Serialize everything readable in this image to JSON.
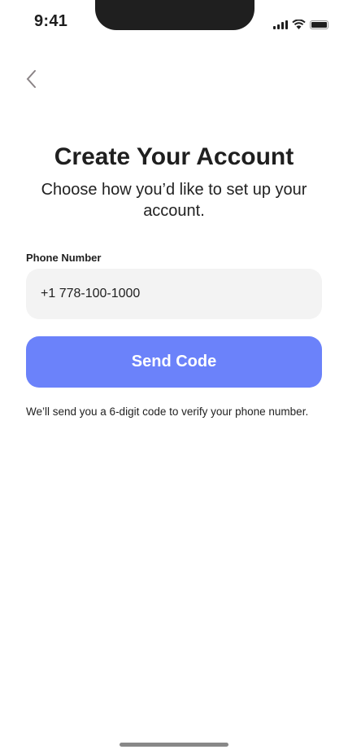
{
  "status_bar": {
    "time": "9:41"
  },
  "header": {
    "title": "Create Your Account",
    "subtitle": "Choose how you’d like to set up your account."
  },
  "form": {
    "phone_label": "Phone Number",
    "phone_value": "+1 778-100-1000",
    "send_label": "Send Code",
    "hint": "We’ll send you a 6-digit code to verify your phone number."
  },
  "colors": {
    "accent": "#6b82fa",
    "input_bg": "#f3f3f3"
  }
}
